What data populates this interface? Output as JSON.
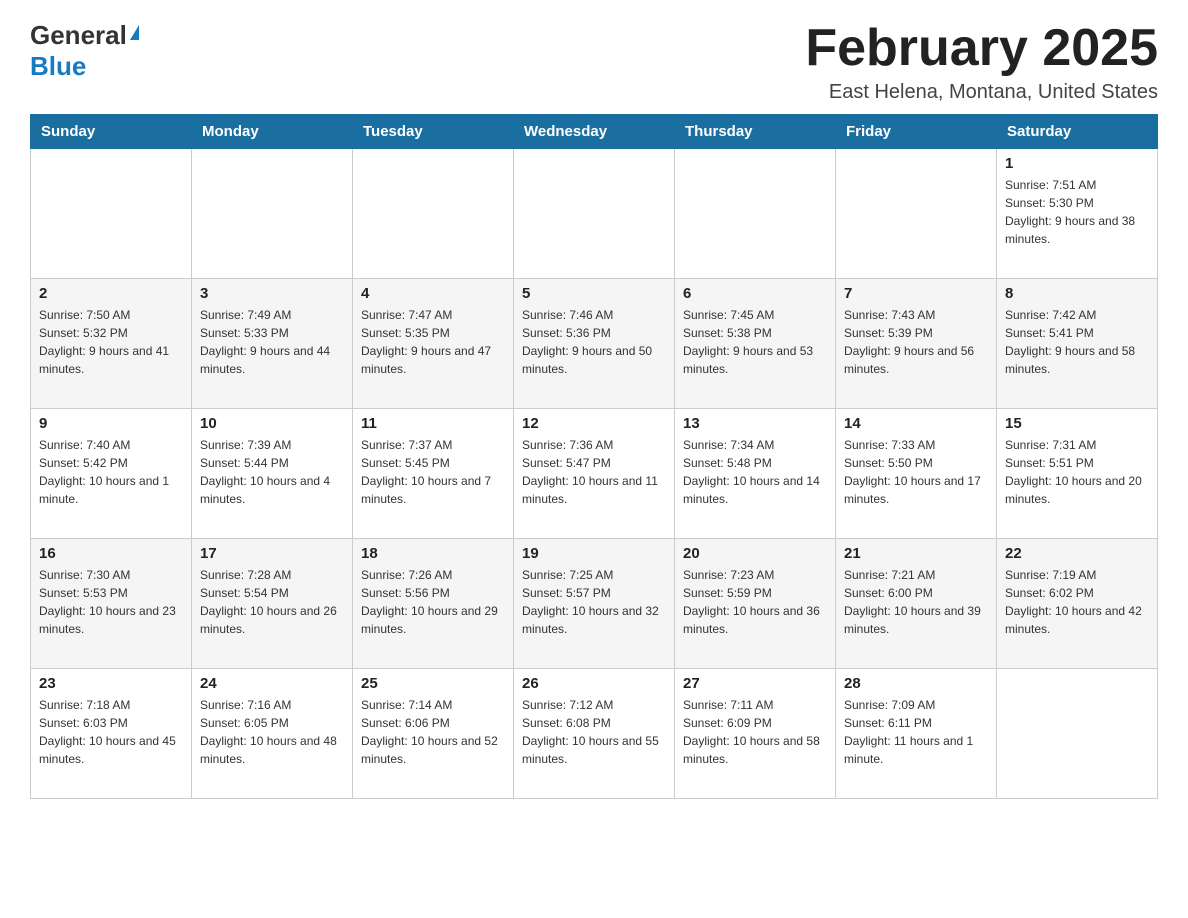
{
  "header": {
    "logo_general": "General",
    "logo_blue": "Blue",
    "title": "February 2025",
    "subtitle": "East Helena, Montana, United States"
  },
  "days_of_week": [
    "Sunday",
    "Monday",
    "Tuesday",
    "Wednesday",
    "Thursday",
    "Friday",
    "Saturday"
  ],
  "weeks": [
    [
      {
        "date": "",
        "info": ""
      },
      {
        "date": "",
        "info": ""
      },
      {
        "date": "",
        "info": ""
      },
      {
        "date": "",
        "info": ""
      },
      {
        "date": "",
        "info": ""
      },
      {
        "date": "",
        "info": ""
      },
      {
        "date": "1",
        "info": "Sunrise: 7:51 AM\nSunset: 5:30 PM\nDaylight: 9 hours and 38 minutes."
      }
    ],
    [
      {
        "date": "2",
        "info": "Sunrise: 7:50 AM\nSunset: 5:32 PM\nDaylight: 9 hours and 41 minutes."
      },
      {
        "date": "3",
        "info": "Sunrise: 7:49 AM\nSunset: 5:33 PM\nDaylight: 9 hours and 44 minutes."
      },
      {
        "date": "4",
        "info": "Sunrise: 7:47 AM\nSunset: 5:35 PM\nDaylight: 9 hours and 47 minutes."
      },
      {
        "date": "5",
        "info": "Sunrise: 7:46 AM\nSunset: 5:36 PM\nDaylight: 9 hours and 50 minutes."
      },
      {
        "date": "6",
        "info": "Sunrise: 7:45 AM\nSunset: 5:38 PM\nDaylight: 9 hours and 53 minutes."
      },
      {
        "date": "7",
        "info": "Sunrise: 7:43 AM\nSunset: 5:39 PM\nDaylight: 9 hours and 56 minutes."
      },
      {
        "date": "8",
        "info": "Sunrise: 7:42 AM\nSunset: 5:41 PM\nDaylight: 9 hours and 58 minutes."
      }
    ],
    [
      {
        "date": "9",
        "info": "Sunrise: 7:40 AM\nSunset: 5:42 PM\nDaylight: 10 hours and 1 minute."
      },
      {
        "date": "10",
        "info": "Sunrise: 7:39 AM\nSunset: 5:44 PM\nDaylight: 10 hours and 4 minutes."
      },
      {
        "date": "11",
        "info": "Sunrise: 7:37 AM\nSunset: 5:45 PM\nDaylight: 10 hours and 7 minutes."
      },
      {
        "date": "12",
        "info": "Sunrise: 7:36 AM\nSunset: 5:47 PM\nDaylight: 10 hours and 11 minutes."
      },
      {
        "date": "13",
        "info": "Sunrise: 7:34 AM\nSunset: 5:48 PM\nDaylight: 10 hours and 14 minutes."
      },
      {
        "date": "14",
        "info": "Sunrise: 7:33 AM\nSunset: 5:50 PM\nDaylight: 10 hours and 17 minutes."
      },
      {
        "date": "15",
        "info": "Sunrise: 7:31 AM\nSunset: 5:51 PM\nDaylight: 10 hours and 20 minutes."
      }
    ],
    [
      {
        "date": "16",
        "info": "Sunrise: 7:30 AM\nSunset: 5:53 PM\nDaylight: 10 hours and 23 minutes."
      },
      {
        "date": "17",
        "info": "Sunrise: 7:28 AM\nSunset: 5:54 PM\nDaylight: 10 hours and 26 minutes."
      },
      {
        "date": "18",
        "info": "Sunrise: 7:26 AM\nSunset: 5:56 PM\nDaylight: 10 hours and 29 minutes."
      },
      {
        "date": "19",
        "info": "Sunrise: 7:25 AM\nSunset: 5:57 PM\nDaylight: 10 hours and 32 minutes."
      },
      {
        "date": "20",
        "info": "Sunrise: 7:23 AM\nSunset: 5:59 PM\nDaylight: 10 hours and 36 minutes."
      },
      {
        "date": "21",
        "info": "Sunrise: 7:21 AM\nSunset: 6:00 PM\nDaylight: 10 hours and 39 minutes."
      },
      {
        "date": "22",
        "info": "Sunrise: 7:19 AM\nSunset: 6:02 PM\nDaylight: 10 hours and 42 minutes."
      }
    ],
    [
      {
        "date": "23",
        "info": "Sunrise: 7:18 AM\nSunset: 6:03 PM\nDaylight: 10 hours and 45 minutes."
      },
      {
        "date": "24",
        "info": "Sunrise: 7:16 AM\nSunset: 6:05 PM\nDaylight: 10 hours and 48 minutes."
      },
      {
        "date": "25",
        "info": "Sunrise: 7:14 AM\nSunset: 6:06 PM\nDaylight: 10 hours and 52 minutes."
      },
      {
        "date": "26",
        "info": "Sunrise: 7:12 AM\nSunset: 6:08 PM\nDaylight: 10 hours and 55 minutes."
      },
      {
        "date": "27",
        "info": "Sunrise: 7:11 AM\nSunset: 6:09 PM\nDaylight: 10 hours and 58 minutes."
      },
      {
        "date": "28",
        "info": "Sunrise: 7:09 AM\nSunset: 6:11 PM\nDaylight: 11 hours and 1 minute."
      },
      {
        "date": "",
        "info": ""
      }
    ]
  ]
}
